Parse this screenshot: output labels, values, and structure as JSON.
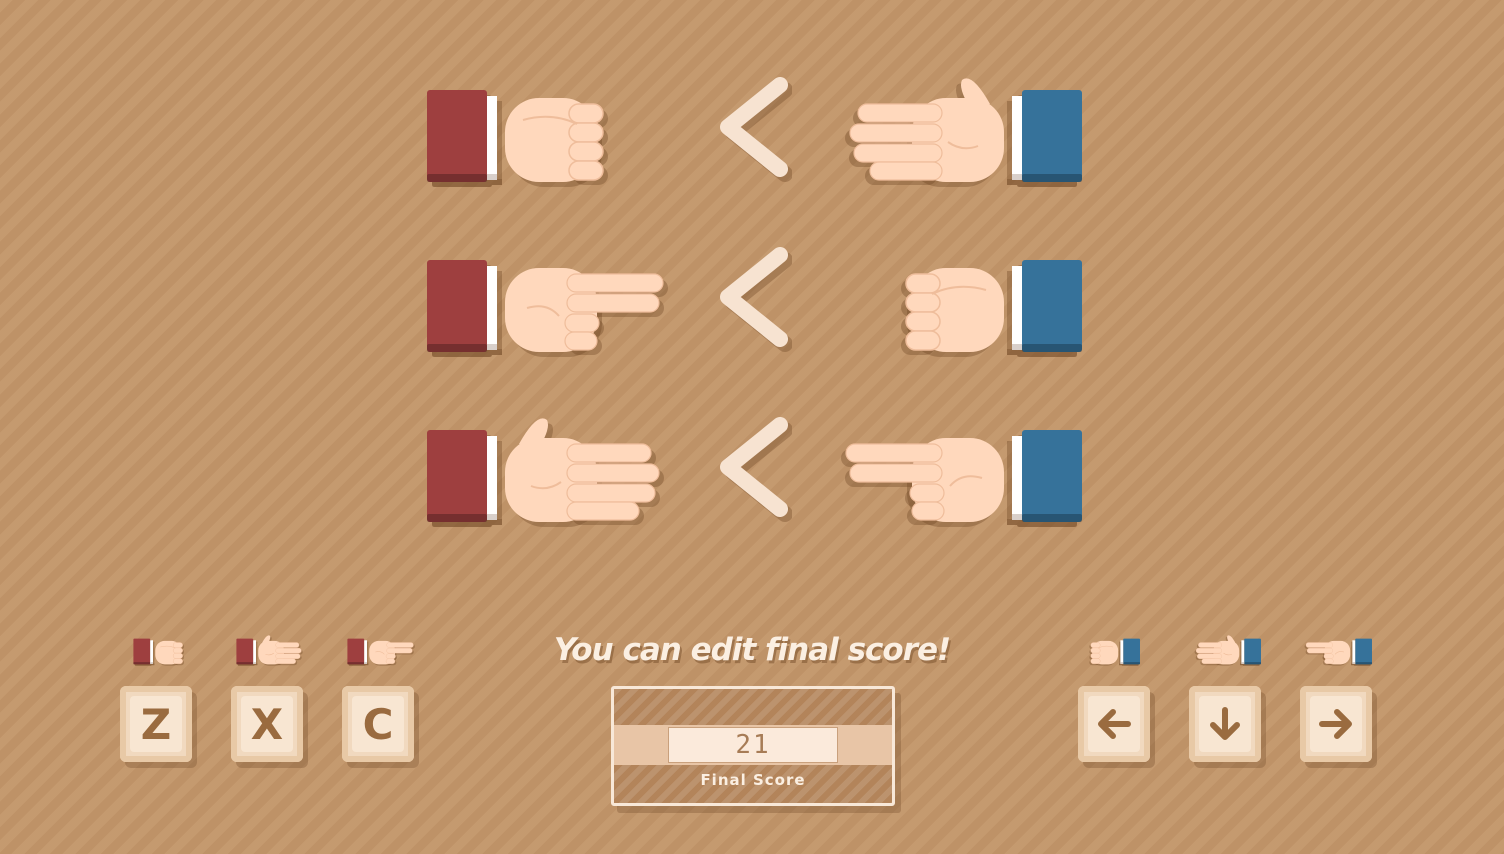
{
  "rules": [
    {
      "left": "rock",
      "operator": "<",
      "right": "paper"
    },
    {
      "left": "scissors",
      "operator": "<",
      "right": "rock"
    },
    {
      "left": "paper",
      "operator": "<",
      "right": "scissors"
    }
  ],
  "players": {
    "red": {
      "sleeve_color": "#9e3f3f",
      "controls": [
        {
          "gesture": "rock",
          "key": "Z"
        },
        {
          "gesture": "paper",
          "key": "X"
        },
        {
          "gesture": "scissors",
          "key": "C"
        }
      ]
    },
    "blue": {
      "sleeve_color": "#36729a",
      "controls": [
        {
          "gesture": "rock",
          "key": "arrow-left-icon"
        },
        {
          "gesture": "paper",
          "key": "arrow-down-icon"
        },
        {
          "gesture": "scissors",
          "key": "arrow-right-icon"
        }
      ]
    }
  },
  "colors": {
    "background": "#c29569",
    "skin": "#ffd8bc",
    "operator": "#f7e3d1",
    "key_text": "#9a6b3f"
  },
  "hint_text": "You can edit final score!",
  "final_score": {
    "value": "21",
    "label": "Final Score"
  }
}
